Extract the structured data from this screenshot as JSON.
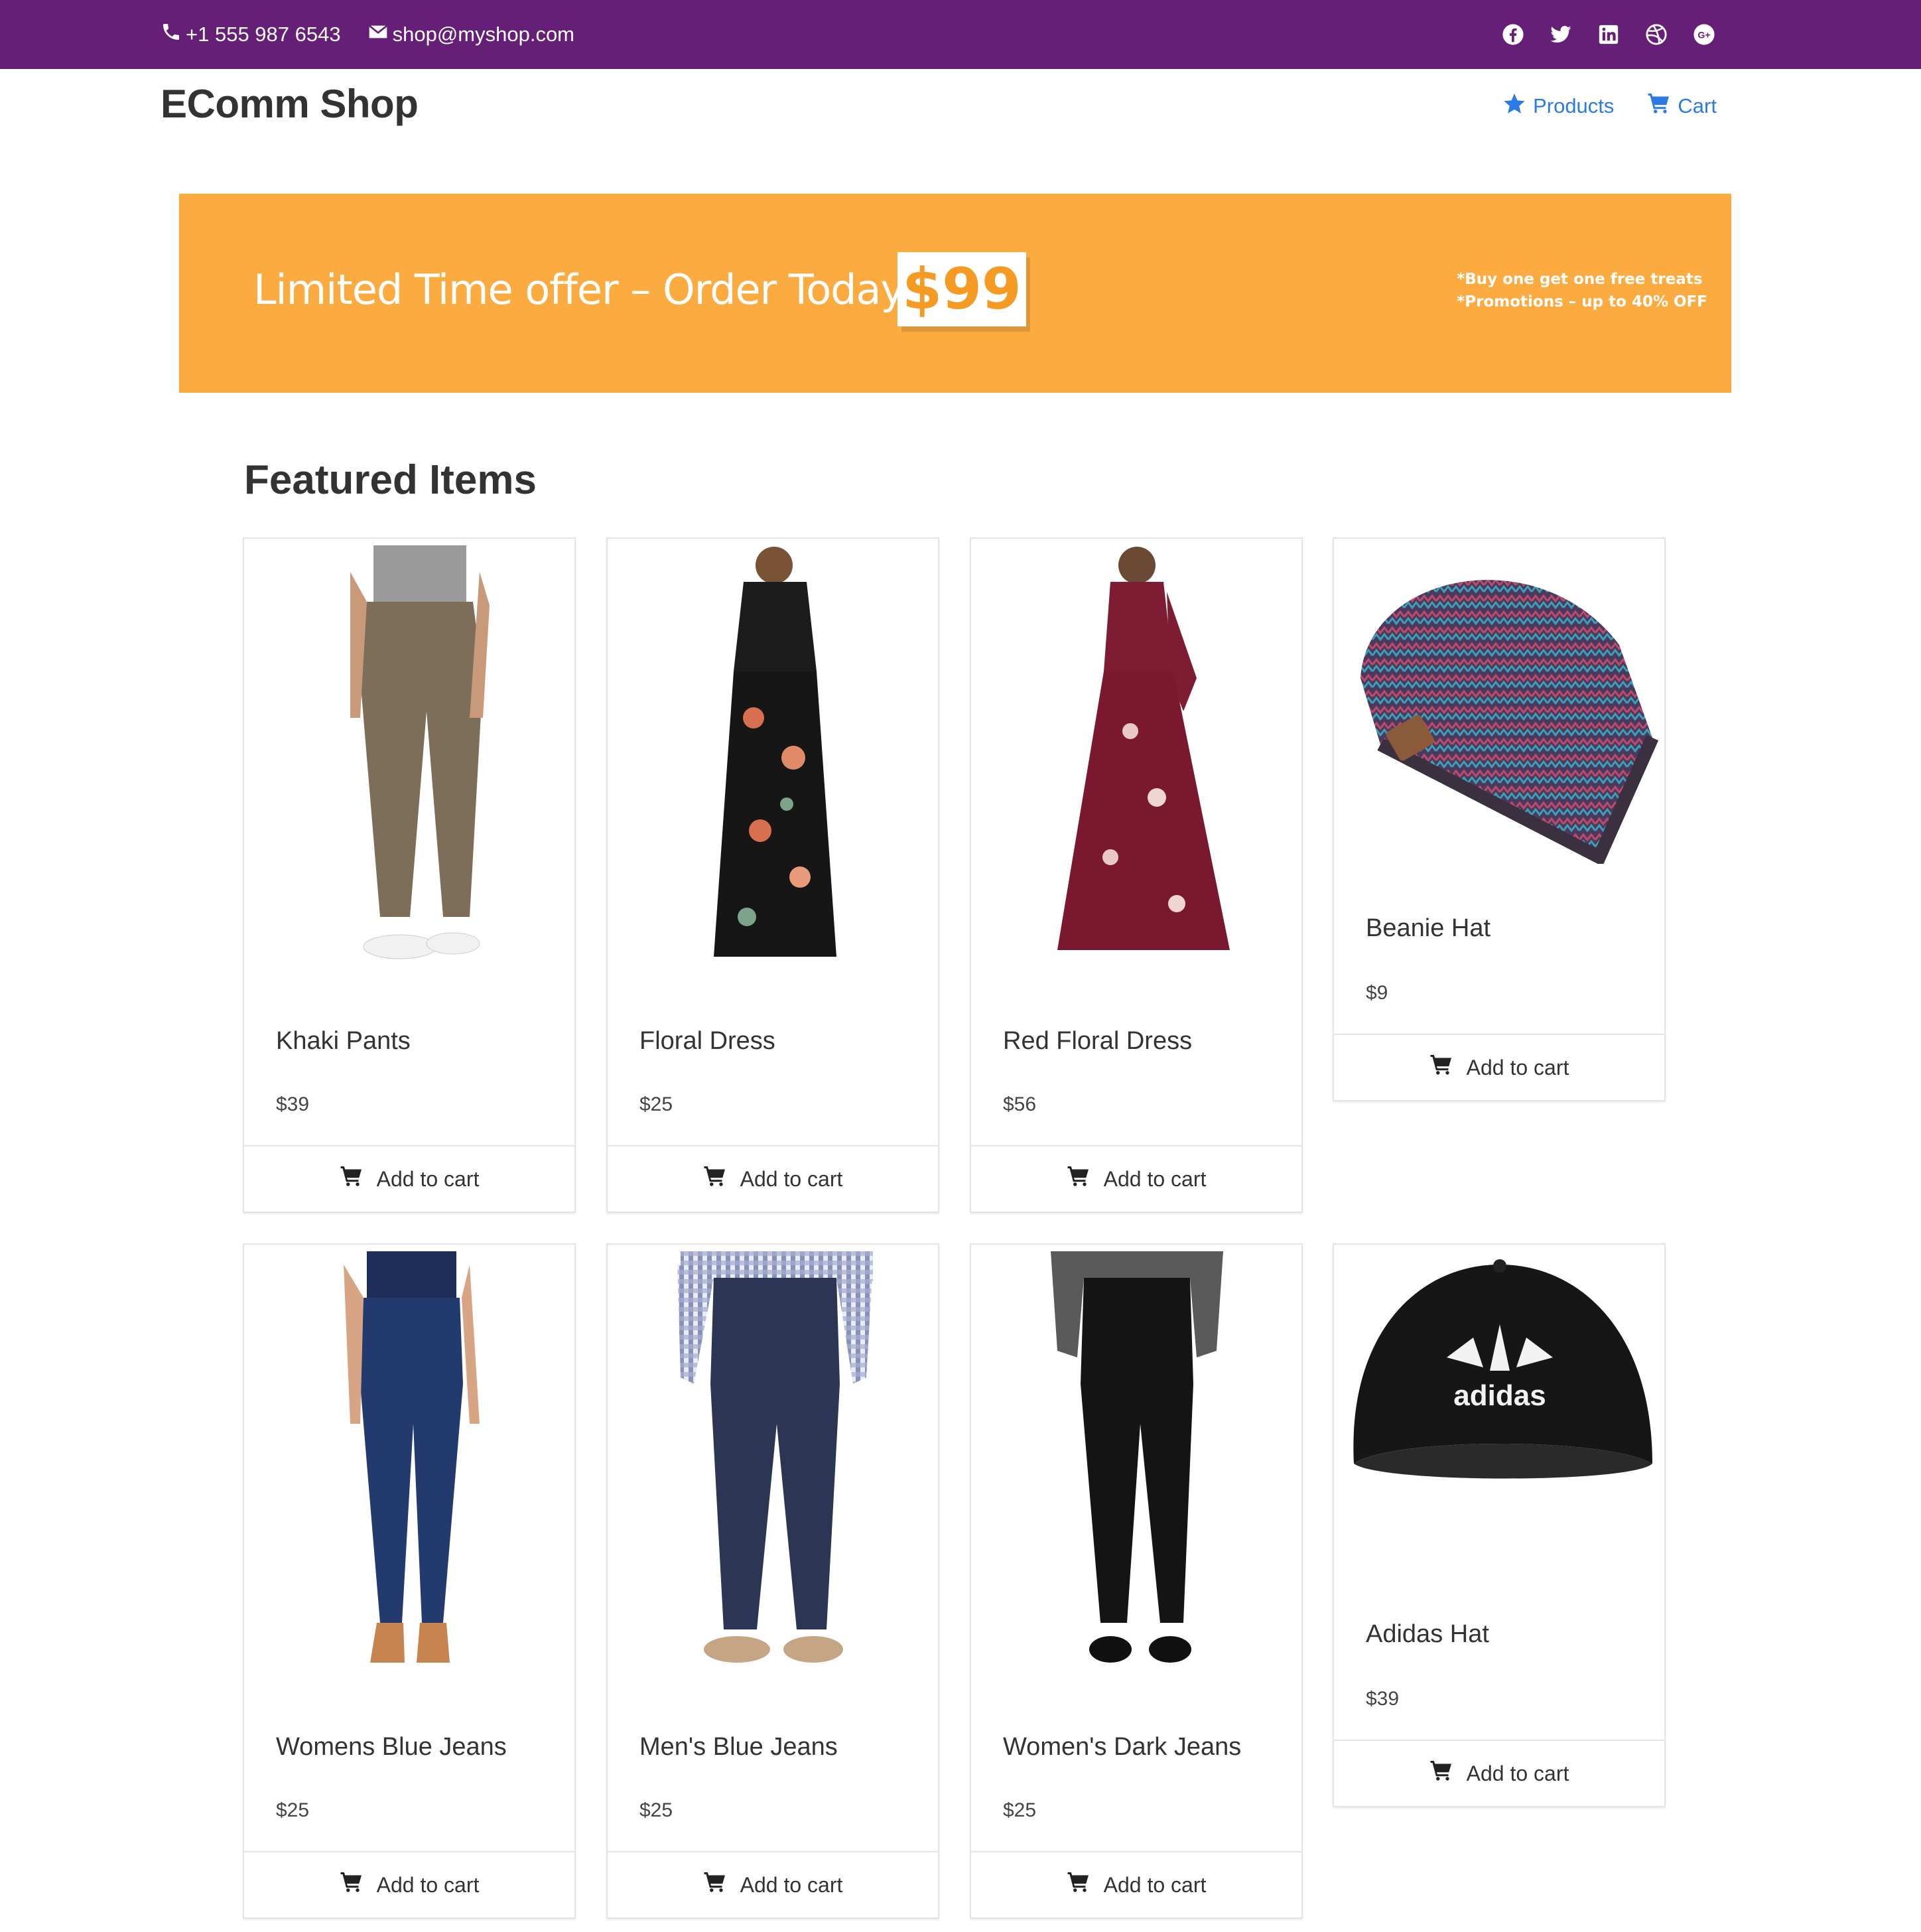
{
  "topbar": {
    "phone": "+1 555 987 6543",
    "email": "shop@myshop.com",
    "social_icons": [
      "facebook-icon",
      "twitter-icon",
      "linkedin-icon",
      "dribbble-icon",
      "google-plus-icon"
    ],
    "background": "#651f77"
  },
  "header": {
    "brand": "EComm Shop",
    "nav": [
      {
        "label": "Products",
        "icon": "star-icon"
      },
      {
        "label": "Cart",
        "icon": "cart-icon"
      }
    ],
    "link_color": "#2c7be5"
  },
  "banner": {
    "headline": "Limited Time offer – Order Today For",
    "price": "$99",
    "promo_line_1": "*Buy one get one free treats",
    "promo_line_2": "*Promotions – up to 40% OFF",
    "background": "#fcab41"
  },
  "featured": {
    "title": "Featured Items",
    "add_to_cart_label": "Add to cart",
    "products": [
      {
        "name": "Khaki Pants",
        "price": "$39",
        "image": "khaki-pants"
      },
      {
        "name": "Floral Dress",
        "price": "$25",
        "image": "floral-dress"
      },
      {
        "name": "Red Floral Dress",
        "price": "$56",
        "image": "red-floral-dress"
      },
      {
        "name": "Beanie Hat",
        "price": "$9",
        "image": "beanie-hat"
      },
      {
        "name": "Womens Blue Jeans",
        "price": "$25",
        "image": "womens-blue-jeans"
      },
      {
        "name": "Men's Blue Jeans",
        "price": "$25",
        "image": "mens-blue-jeans"
      },
      {
        "name": "Women's Dark Jeans",
        "price": "$25",
        "image": "womens-dark-jeans"
      },
      {
        "name": "Adidas Hat",
        "price": "$39",
        "image": "adidas-hat"
      }
    ]
  }
}
